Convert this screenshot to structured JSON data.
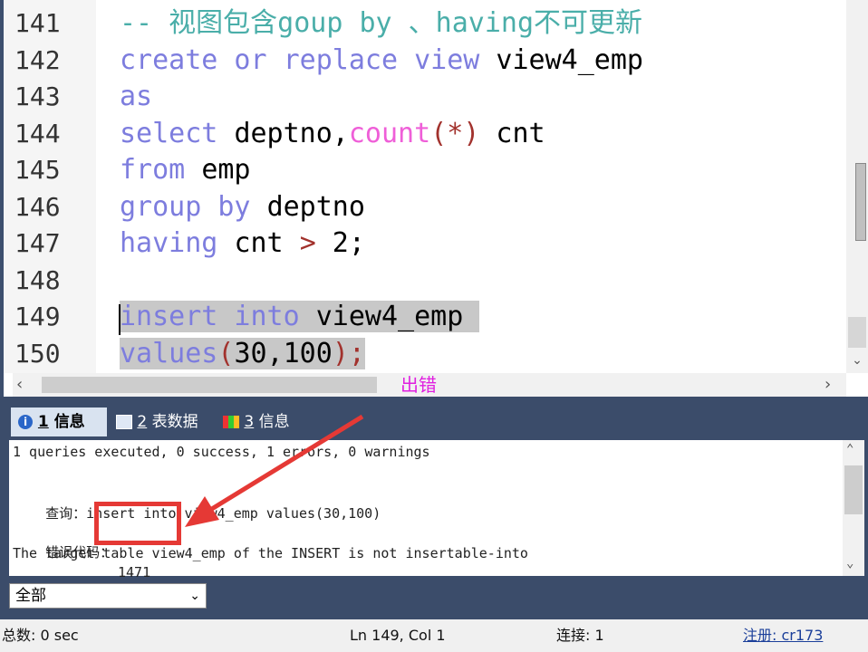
{
  "editor": {
    "lines": [
      {
        "num": "141",
        "parts": [
          {
            "t": "-- 视图包含goup by 、having不可更新",
            "c": "cm"
          }
        ]
      },
      {
        "num": "142",
        "parts": [
          {
            "t": "create or replace view ",
            "c": "kw"
          },
          {
            "t": "view4_emp",
            "c": ""
          }
        ]
      },
      {
        "num": "143",
        "parts": [
          {
            "t": "as",
            "c": "kw"
          }
        ]
      },
      {
        "num": "144",
        "parts": [
          {
            "t": "select ",
            "c": "kw"
          },
          {
            "t": "deptno,",
            "c": ""
          },
          {
            "t": "count",
            "c": "fn"
          },
          {
            "t": "(*)",
            "c": "op"
          },
          {
            "t": " cnt",
            "c": ""
          }
        ]
      },
      {
        "num": "145",
        "parts": [
          {
            "t": "from ",
            "c": "kw"
          },
          {
            "t": "emp",
            "c": ""
          }
        ]
      },
      {
        "num": "146",
        "parts": [
          {
            "t": "group by ",
            "c": "kw"
          },
          {
            "t": "deptno",
            "c": ""
          }
        ]
      },
      {
        "num": "147",
        "parts": [
          {
            "t": "having ",
            "c": "kw"
          },
          {
            "t": "cnt ",
            "c": ""
          },
          {
            "t": ">",
            "c": "op"
          },
          {
            "t": " 2;",
            "c": ""
          }
        ]
      },
      {
        "num": "148",
        "parts": []
      },
      {
        "num": "149",
        "sel": true,
        "parts": [
          {
            "t": "insert into ",
            "c": "kw"
          },
          {
            "t": "view4_emp ",
            "c": ""
          }
        ]
      },
      {
        "num": "150",
        "sel": true,
        "parts": [
          {
            "t": "values",
            "c": "kw"
          },
          {
            "t": "(",
            "c": "op"
          },
          {
            "t": "30,100",
            "c": ""
          },
          {
            "t": ");",
            "c": "op"
          }
        ]
      }
    ],
    "annotation": "出错"
  },
  "tabs": [
    {
      "num": "1",
      "label": "信息",
      "icon": "info-icon",
      "active": true
    },
    {
      "num": "2",
      "label": "表数据",
      "icon": "table-icon",
      "active": false
    },
    {
      "num": "3",
      "label": "信息",
      "icon": "blocks-icon",
      "active": false
    }
  ],
  "messages": {
    "summary": "1 queries executed, 0 success, 1 errors, 0 warnings",
    "query_label": "查询：",
    "query_text": "insert into view4_emp values(30,100)",
    "error_label": "错误代码：",
    "error_code": "1471",
    "error_text": "The target table view4_emp of the INSERT is not insertable-into"
  },
  "filter": {
    "value": "全部"
  },
  "status": {
    "time": "总数: 0 sec",
    "position": "Ln 149, Col 1",
    "connections": "连接: 1",
    "register": "注册: cr173"
  },
  "colors": {
    "keyword": "#7d7dde",
    "comment": "#4aaea9",
    "function": "#ef5fd8",
    "operator": "#a2322d",
    "highlight": "#e53935",
    "annotation": "#e020e0"
  }
}
